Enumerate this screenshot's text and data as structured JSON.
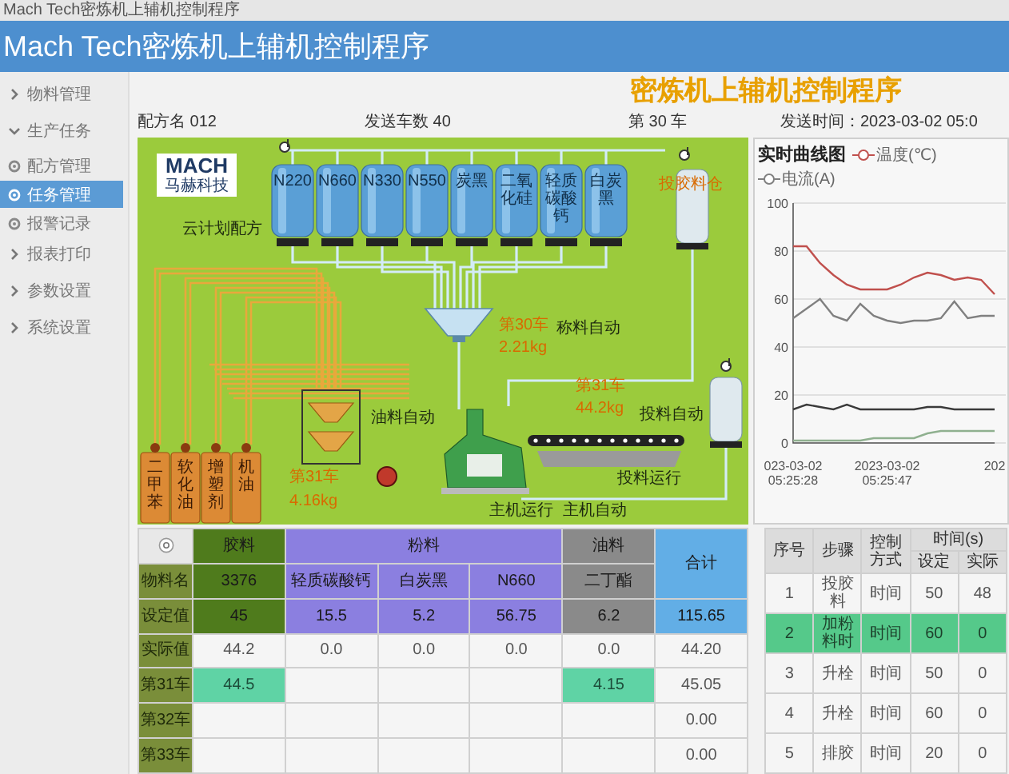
{
  "window": {
    "title": "Mach Tech密炼机上辅机控制程序"
  },
  "header": {
    "title": "Mach Tech密炼机上辅机控制程序"
  },
  "sidebar": {
    "items": [
      {
        "label": "物料管理",
        "expanded": false
      },
      {
        "label": "生产任务",
        "expanded": true,
        "children": [
          {
            "label": "配方管理",
            "selected": false
          },
          {
            "label": "任务管理",
            "selected": true
          },
          {
            "label": "报警记录",
            "selected": false
          }
        ]
      },
      {
        "label": "报表打印",
        "expanded": false
      },
      {
        "label": "参数设置",
        "expanded": false
      },
      {
        "label": "系统设置",
        "expanded": false
      }
    ]
  },
  "page_title": "密炼机上辅机控制程序",
  "info": {
    "recipe": "配方名 012",
    "cars_sent": "发送车数  40",
    "current_car": "第 30 车",
    "send_time": "发送时间：2023-03-02 05:0"
  },
  "diagram": {
    "logo": {
      "mark": "MACH",
      "name": "马赫科技"
    },
    "recipe_source": "云计划配方",
    "silos": [
      {
        "label": "N220"
      },
      {
        "label": "N660"
      },
      {
        "label": "N330"
      },
      {
        "label": "N550"
      },
      {
        "label": "炭黑"
      },
      {
        "label": "二氧化硅"
      },
      {
        "label": "轻质碳酸钙"
      },
      {
        "label": "白炭黑"
      }
    ],
    "rubber_bin": "投胶料仓",
    "powder_scale": {
      "car": "第30车",
      "weight": "2.21kg",
      "mode": "称料自动"
    },
    "rubber_scale": {
      "car": "第31车",
      "weight": "44.2kg"
    },
    "oil_scale": {
      "car": "第31车",
      "weight": "4.16kg",
      "mode": "油料自动"
    },
    "oil_tanks": [
      {
        "label": "二甲苯"
      },
      {
        "label": "软化油"
      },
      {
        "label": "增塑剂"
      },
      {
        "label": "机油"
      }
    ],
    "status_tags": [
      "投料自动",
      "投料运行",
      "主机运行",
      "主机自动"
    ]
  },
  "chart": {
    "title": "实时曲线图",
    "chart_data": {
      "type": "line",
      "categories": [
        "023-03-02 05:25:28",
        null,
        null,
        null,
        null,
        null,
        null,
        "2023-03-02 05:25:47",
        null,
        null,
        null,
        null,
        null,
        null,
        null,
        "202"
      ],
      "ylim": [
        0,
        100
      ],
      "yticks": [
        0,
        20,
        40,
        60,
        80,
        100
      ],
      "grid": true,
      "legend": "top",
      "series": [
        {
          "name": "温度(℃)",
          "color": "#c0504d",
          "values": [
            82,
            82,
            75,
            70,
            66,
            64,
            64,
            64,
            66,
            69,
            71,
            70,
            68,
            69,
            68,
            62
          ]
        },
        {
          "name": "电流(A)",
          "color": "#808080",
          "values": [
            52,
            56,
            60,
            53,
            51,
            58,
            53,
            51,
            50,
            51,
            51,
            52,
            59,
            52,
            53,
            53
          ]
        },
        {
          "color": "#3a3a3a",
          "values": [
            14,
            16,
            15,
            14,
            16,
            14,
            14,
            14,
            14,
            14,
            15,
            15,
            14,
            14,
            14,
            14
          ]
        },
        {
          "color": "#8fb08f",
          "values": [
            1,
            1,
            1,
            1,
            1,
            1,
            2,
            2,
            2,
            2,
            4,
            5,
            5,
            5,
            5,
            5
          ]
        }
      ]
    }
  },
  "materials_table": {
    "groups": [
      {
        "label": "胶料",
        "color": "#4f7b1c"
      },
      {
        "label": "粉料",
        "color": "#8b7fe0"
      },
      {
        "label": "油料",
        "color": "#8a8a8a"
      }
    ],
    "total_label": "合计",
    "rows": [
      {
        "label": "物料名",
        "kind": "group",
        "cells": [
          "3376",
          "轻质碳酸钙",
          "白炭黑",
          "N660",
          "二丁酯"
        ]
      },
      {
        "label": "设定值",
        "kind": "group",
        "cells": [
          "45",
          "15.5",
          "5.2",
          "56.75",
          "6.2"
        ],
        "total": "115.65"
      },
      {
        "label": "实际值",
        "kind": "data",
        "cells": [
          {
            "text": "44.2",
            "highlighted": false
          },
          {
            "text": "0.0",
            "highlighted": false
          },
          {
            "text": "0.0",
            "highlighted": false
          },
          {
            "text": "0.0",
            "highlighted": false
          },
          {
            "text": "0.0",
            "highlighted": false
          }
        ],
        "total": "44.20"
      },
      {
        "label": "第31车",
        "kind": "data",
        "cells": [
          {
            "text": "44.5",
            "highlighted": true
          },
          {
            "highlighted": false
          },
          {
            "highlighted": false
          },
          {
            "highlighted": false
          },
          {
            "text": "4.15",
            "highlighted": true
          }
        ],
        "total": "45.05"
      },
      {
        "label": "第32车",
        "kind": "data",
        "cells": [
          {
            "highlighted": false
          },
          {
            "highlighted": false
          },
          {
            "highlighted": false
          },
          {
            "highlighted": false
          },
          {
            "highlighted": false
          }
        ],
        "total": "0.00"
      },
      {
        "label": "第33车",
        "kind": "data",
        "cells": [
          {
            "highlighted": false
          },
          {
            "highlighted": false
          },
          {
            "highlighted": false
          },
          {
            "highlighted": false
          },
          {
            "highlighted": false
          }
        ],
        "total": "0.00"
      }
    ]
  },
  "steps_table": {
    "columns": [
      "序号",
      "步骤",
      "控制方式"
    ],
    "time_group": "时间(s)",
    "time_columns": [
      "设定",
      "实际"
    ],
    "rows": [
      {
        "no": "1",
        "step": "投胶料",
        "mode": "时间",
        "set": "50",
        "actual": "48",
        "selected": false
      },
      {
        "no": "2",
        "step": "加粉料时",
        "mode": "时间",
        "set": "60",
        "actual": "0",
        "selected": true
      },
      {
        "no": "3",
        "step": "升栓",
        "mode": "时间",
        "set": "50",
        "actual": "0",
        "selected": false
      },
      {
        "no": "4",
        "step": "升栓",
        "mode": "时间",
        "set": "60",
        "actual": "0",
        "selected": false
      },
      {
        "no": "5",
        "step": "排胶",
        "mode": "时间",
        "set": "20",
        "actual": "0",
        "selected": false
      }
    ]
  }
}
